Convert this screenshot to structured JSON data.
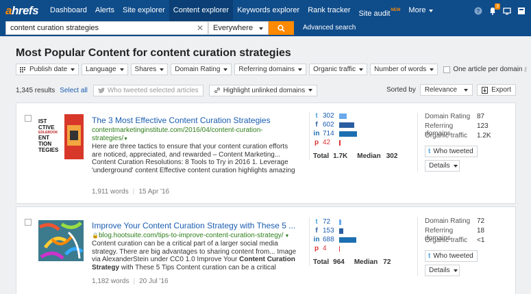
{
  "app": {
    "logo_a": "a",
    "logo_rest": "hrefs"
  },
  "nav": {
    "items": [
      {
        "label": "Dashboard"
      },
      {
        "label": "Alerts"
      },
      {
        "label": "Site explorer"
      },
      {
        "label": "Content explorer"
      },
      {
        "label": "Keywords explorer"
      },
      {
        "label": "Rank tracker"
      },
      {
        "label": "Site audit"
      },
      {
        "label": "More"
      }
    ],
    "new_badge": "NEW",
    "notification_count": "3"
  },
  "search": {
    "query": "content curation strategies",
    "scope": "Everywhere",
    "advanced": "Advanced search"
  },
  "page": {
    "title": "Most Popular Content for content curation strategies"
  },
  "filters": {
    "items": [
      "Publish date",
      "Language",
      "Shares",
      "Domain Rating",
      "Referring domains",
      "Organic traffic",
      "Number of words"
    ],
    "one_article": "One article per domain"
  },
  "results": {
    "count": "1,345 results",
    "select_all": "Select all",
    "who_tweeted_selected": "Who tweeted selected articles",
    "highlight_unlinked": "Highlight unlinked domains",
    "sorted_by": "Sorted by",
    "sort_value": "Relevance",
    "export": "Export"
  },
  "labels": {
    "total": "Total",
    "median": "Median",
    "who_tweeted": "Who tweeted",
    "details": "Details",
    "domain_rating": "Domain Rating",
    "referring_domains": "Referring domains",
    "organic_traffic": "Organic traffic"
  },
  "articles": [
    {
      "title": "The 3 Most Effective Content Curation Strategies",
      "url_line1": "contentmarketinginstitute.com/2016/04/content-curation-",
      "url_line2": "strategies/",
      "snippet_parts": [
        "Here are three tactics to ensure that your content curation efforts are noticed, appreciated, and rewarded – Content Marketing... Content Curation Resolutions: 8 Tools to Try in 2016 1. Leverage 'underground' content Effective content curation highlights amazing"
      ],
      "words": "1,911 words",
      "date": "15 Apr '16",
      "thumb_text": [
        "IST",
        "CTIVE",
        "ENT",
        "TION",
        "TEGIES"
      ],
      "shares": {
        "twitter": {
          "value": "302",
          "fraction": 0.42
        },
        "facebook": {
          "value": "602",
          "fraction": 0.84
        },
        "linkedin": {
          "value": "714",
          "fraction": 1.0
        },
        "pinterest": {
          "value": "42",
          "fraction": 0.06
        }
      },
      "total": "1.7K",
      "median": "302",
      "domain_rating": "87",
      "referring_domains": "123",
      "organic_traffic": "1.2K"
    },
    {
      "title": "Improve Your Content Curation Strategy with These 5 ...",
      "url_line1": "blog.hootsuite.com/tips-to-improve-content-curation-strategy/",
      "url_line2": "",
      "snippet_a": "Content curation can be a critical part of a larger social media strategy. There are big advantages to sharing content from... Image via AlexanderStein under CC0 1.0 Improve Your ",
      "snippet_bold": "Content Curation Strategy",
      "snippet_b": " with These 5 Tips Content curation can be a critical",
      "words": "1,182 words",
      "date": "20 Jul '16",
      "shares": {
        "twitter": {
          "value": "72",
          "fraction": 0.1
        },
        "facebook": {
          "value": "153",
          "fraction": 0.22
        },
        "linkedin": {
          "value": "688",
          "fraction": 0.96
        },
        "pinterest": {
          "value": "4",
          "fraction": 0.01
        }
      },
      "total": "964",
      "median": "72",
      "domain_rating": "72",
      "referring_domains": "18",
      "organic_traffic": "<1"
    }
  ],
  "colors": {
    "nav_bg": "#0f4c8a",
    "accent": "#ff8a00",
    "link": "#1a5cb0",
    "url_green": "#2e7d1a"
  }
}
